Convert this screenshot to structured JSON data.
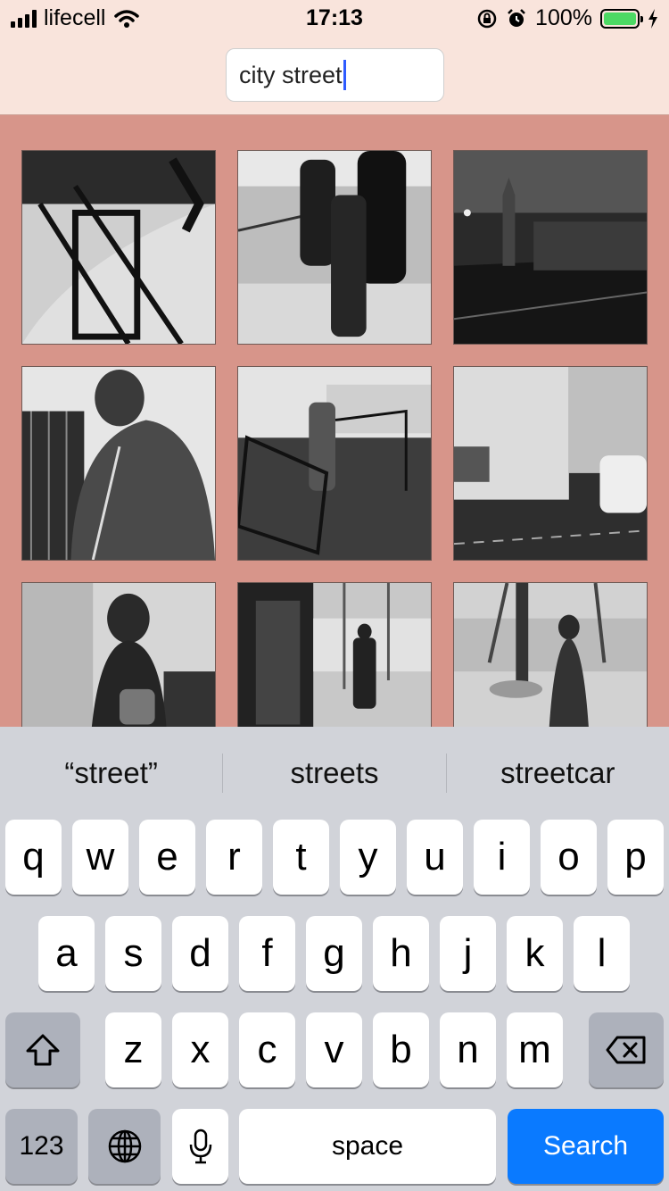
{
  "status": {
    "carrier": "lifecell",
    "time": "17:13",
    "battery": "100%"
  },
  "search": {
    "value": "city street"
  },
  "photos": [
    {
      "subject": "bench-shadow"
    },
    {
      "subject": "people-sidewalk"
    },
    {
      "subject": "night-street"
    },
    {
      "subject": "man-jacket"
    },
    {
      "subject": "street-worker"
    },
    {
      "subject": "corner-car"
    },
    {
      "subject": "woman-phone"
    },
    {
      "subject": "man-walking"
    },
    {
      "subject": "woman-coat"
    }
  ],
  "keyboard": {
    "suggestions": [
      "“street”",
      "streets",
      "streetcar"
    ],
    "row1": [
      "q",
      "w",
      "e",
      "r",
      "t",
      "y",
      "u",
      "i",
      "o",
      "p"
    ],
    "row2": [
      "a",
      "s",
      "d",
      "f",
      "g",
      "h",
      "j",
      "k",
      "l"
    ],
    "row3": [
      "z",
      "x",
      "c",
      "v",
      "b",
      "n",
      "m"
    ],
    "numbers_label": "123",
    "space_label": "space",
    "search_label": "Search"
  }
}
